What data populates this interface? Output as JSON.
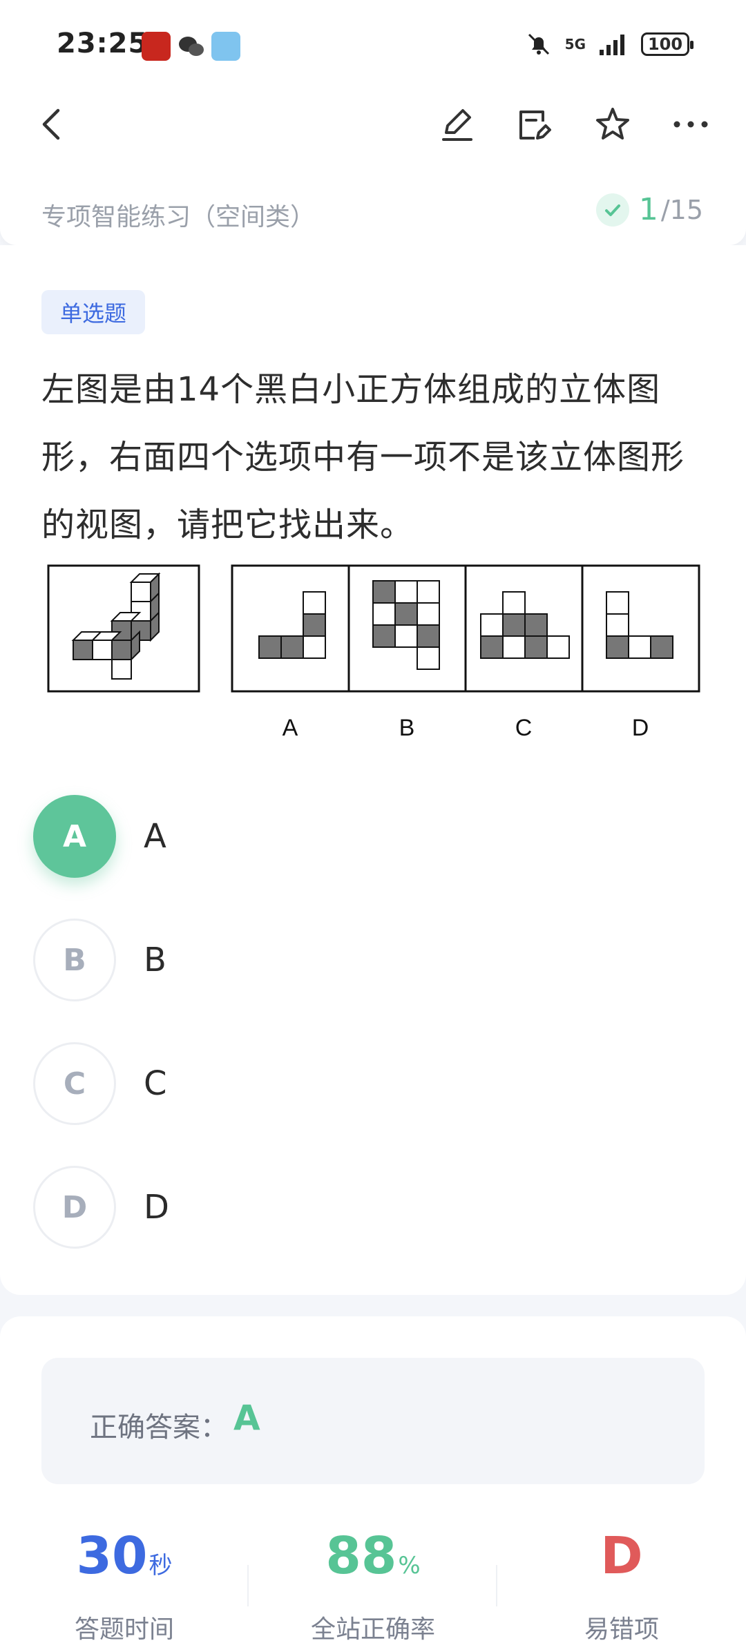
{
  "status_bar": {
    "time": "23:25",
    "network": "5G",
    "battery": "100"
  },
  "icons": {
    "back": "chevron-left-icon",
    "edit": "pencil-icon",
    "note": "note-edit-icon",
    "favorite": "star-icon",
    "more": "more-dots-icon"
  },
  "header": {
    "section_title": "专项智能练习（空间类）",
    "current": "1",
    "total": "/15"
  },
  "question": {
    "type_tag": "单选题",
    "text": "左图是由14个黑白小正方体组成的立体图形，右面四个选项中有一项不是该立体图形的视图，请把它找出来。",
    "figure_labels": [
      "A",
      "B",
      "C",
      "D"
    ]
  },
  "options": [
    {
      "letter": "A",
      "text": "A",
      "state": "correct"
    },
    {
      "letter": "B",
      "text": "B",
      "state": "normal"
    },
    {
      "letter": "C",
      "text": "C",
      "state": "normal"
    },
    {
      "letter": "D",
      "text": "D",
      "state": "normal"
    }
  ],
  "answer": {
    "label": "正确答案：",
    "value": "A"
  },
  "stats": {
    "time_value": "30",
    "time_unit": "秒",
    "time_label": "答题时间",
    "rate_value": "88",
    "rate_unit": "%",
    "rate_label": "全站正确率",
    "error_value": "D",
    "error_label": "易错项"
  },
  "colors": {
    "accent_green": "#57c495",
    "accent_blue": "#3d6ae0",
    "accent_red": "#e05a5a"
  }
}
